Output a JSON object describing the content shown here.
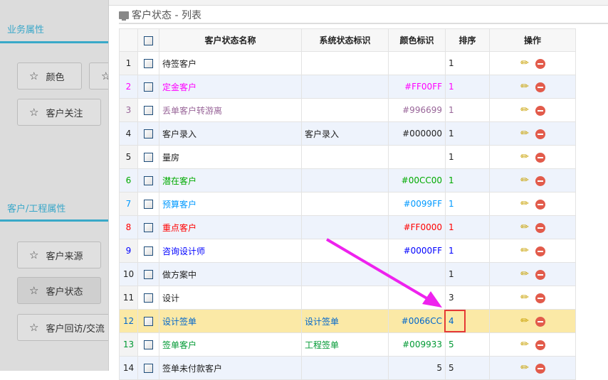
{
  "left": {
    "sections": [
      {
        "title": "业务属性",
        "buttons": [
          "颜色",
          "客户关注"
        ]
      },
      {
        "title": "客户/工程属性",
        "buttons": [
          "客户来源",
          "客户状态",
          "客户回访/交流"
        ]
      }
    ]
  },
  "main": {
    "title": "客户状态 - 列表",
    "headers": [
      "客户状态名称",
      "系统状态标识",
      "颜色标识",
      "排序",
      "操作"
    ],
    "rows": [
      {
        "n": "1",
        "name": "待签客户",
        "sys": "",
        "color": "",
        "sort": "1",
        "fg": "#222222"
      },
      {
        "n": "2",
        "name": "定金客户",
        "sys": "",
        "color": "#FF00FF",
        "sort": "1",
        "fg": "#FF00FF"
      },
      {
        "n": "3",
        "name": "丢单客户转游离",
        "sys": "",
        "color": "#996699",
        "sort": "1",
        "fg": "#996699"
      },
      {
        "n": "4",
        "name": "客户录入",
        "sys": "客户录入",
        "color": "#000000",
        "sort": "1",
        "fg": "#222222"
      },
      {
        "n": "5",
        "name": "量房",
        "sys": "",
        "color": "",
        "sort": "1",
        "fg": "#222222"
      },
      {
        "n": "6",
        "name": "潜在客户",
        "sys": "",
        "color": "#00CC00",
        "sort": "1",
        "fg": "#00AA00"
      },
      {
        "n": "7",
        "name": "预算客户",
        "sys": "",
        "color": "#0099FF",
        "sort": "1",
        "fg": "#0099FF"
      },
      {
        "n": "8",
        "name": "重点客户",
        "sys": "",
        "color": "#FF0000",
        "sort": "1",
        "fg": "#FF0000"
      },
      {
        "n": "9",
        "name": "咨询设计师",
        "sys": "",
        "color": "#0000FF",
        "sort": "1",
        "fg": "#0000FF"
      },
      {
        "n": "10",
        "name": "做方案中",
        "sys": "",
        "color": "",
        "sort": "1",
        "fg": "#222222"
      },
      {
        "n": "11",
        "name": "设计",
        "sys": "",
        "color": "",
        "sort": "3",
        "fg": "#222222"
      },
      {
        "n": "12",
        "name": "设计签单",
        "sys": "设计签单",
        "color": "#0066CC",
        "sort": "4",
        "fg": "#0066CC"
      },
      {
        "n": "13",
        "name": "签单客户",
        "sys": "工程签单",
        "color": "#009933",
        "sort": "5",
        "fg": "#009933"
      },
      {
        "n": "14",
        "name": "签单未付款客户",
        "sys": "",
        "color": "5",
        "sort": "5",
        "fg": "#222222"
      }
    ]
  }
}
